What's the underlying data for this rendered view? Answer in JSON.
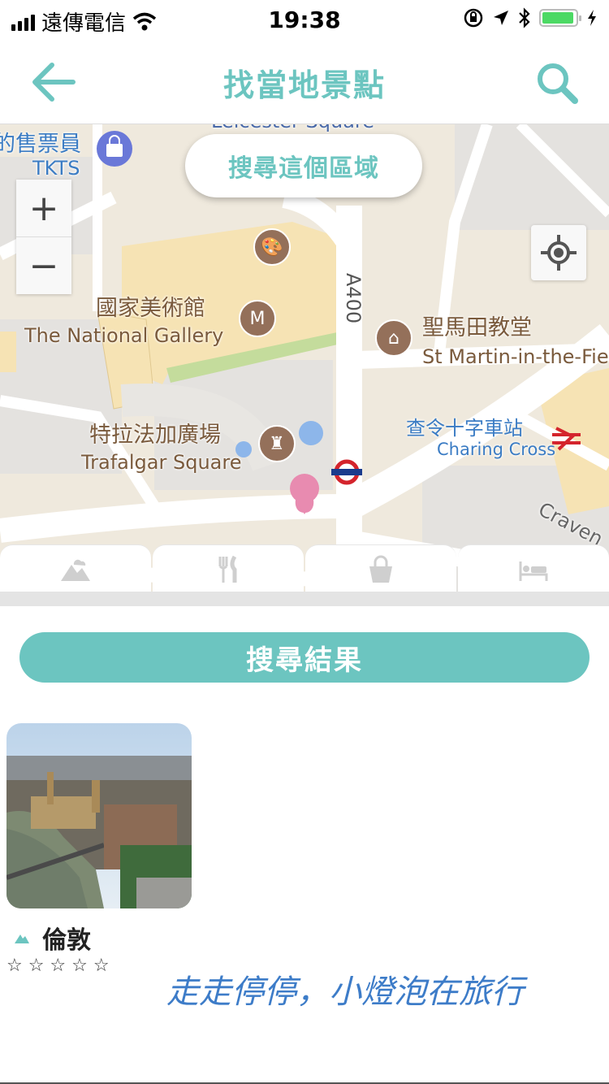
{
  "status_bar": {
    "carrier": "遠傳電信",
    "time": "19:38",
    "battery_level": 0.95,
    "battery_color": "#4cd964"
  },
  "navbar": {
    "title": "找當地景點",
    "back_icon": "arrow-left-icon",
    "search_icon": "search-icon",
    "accent_color": "#6cc5c0"
  },
  "map": {
    "search_area_button": "搜尋這個區域",
    "zoom_in_label": "+",
    "zoom_out_label": "−",
    "labels": {
      "leicester": "Leicester Square",
      "tkts_zh": "的售票員",
      "tkts_en": "TKTS",
      "gallery_zh": "國家美術館",
      "gallery_en": "The National Gallery",
      "a400": "A400",
      "church_zh": "聖馬田教堂",
      "church_en": "St Martin-in-the-Fie",
      "charing_zh": "查令十字車站",
      "charing_en": "Charing Cross",
      "trafalgar_zh": "特拉法加廣場",
      "trafalgar_en": "Trafalgar Square",
      "craven": "Craven"
    }
  },
  "category_tabs": [
    {
      "icon": "mountain-icon"
    },
    {
      "icon": "fork-knife-icon"
    },
    {
      "icon": "shopping-basket-icon"
    },
    {
      "icon": "bed-icon"
    }
  ],
  "results": {
    "heading": "搜尋結果",
    "items": [
      {
        "title": "倫敦",
        "category_icon": "mountain-icon",
        "rating": 0,
        "rating_max": 5,
        "stars_display": "☆ ☆ ☆ ☆ ☆"
      }
    ]
  },
  "watermark": "走走停停，小燈泡在旅行"
}
